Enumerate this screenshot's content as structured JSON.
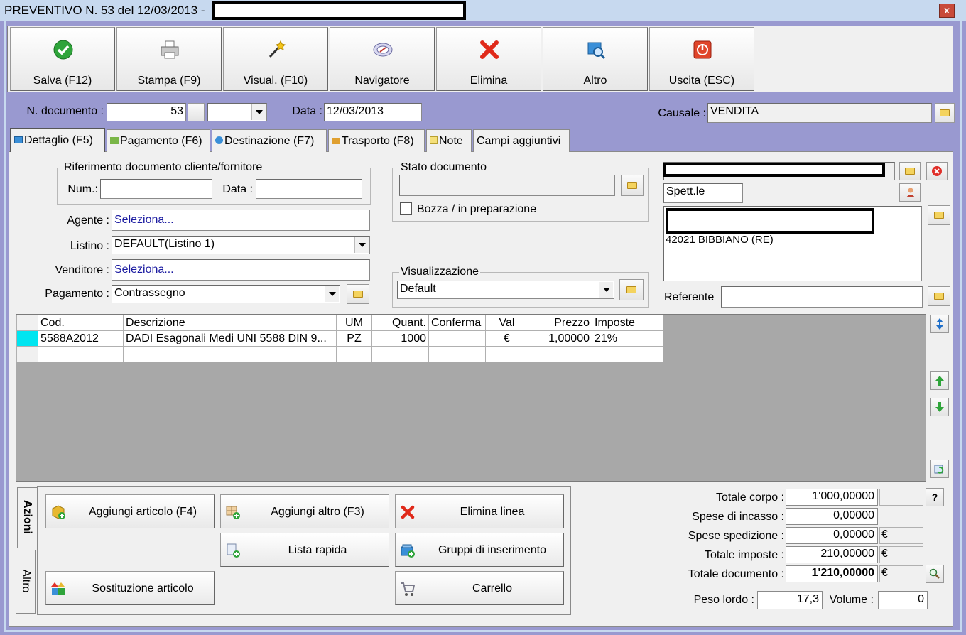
{
  "window": {
    "title": "PREVENTIVO N. 53 del 12/03/2013 -",
    "close": "x"
  },
  "toolbar": [
    {
      "label": "Salva (F12)",
      "icon": "check-icon"
    },
    {
      "label": "Stampa (F9)",
      "icon": "printer-icon"
    },
    {
      "label": "Visual. (F10)",
      "icon": "magic-wand-icon"
    },
    {
      "label": "Navigatore",
      "icon": "compass-icon"
    },
    {
      "label": "Elimina",
      "icon": "delete-x-icon"
    },
    {
      "label": "Altro",
      "icon": "more-icon"
    },
    {
      "label": "Uscita (ESC)",
      "icon": "power-icon"
    }
  ],
  "header": {
    "doc_number_label": "N. documento :",
    "doc_number": "53",
    "date_label": "Data :",
    "date": "12/03/2013",
    "causale_label": "Causale :",
    "causale": "VENDITA"
  },
  "tabs": [
    "Dettaglio (F5)",
    "Pagamento (F6)",
    "Destinazione (F7)",
    "Trasporto (F8)",
    "Note",
    "Campi aggiuntivi"
  ],
  "riferimento": {
    "title": "Riferimento documento cliente/fornitore",
    "num_label": "Num.:",
    "num": "",
    "data_label": "Data :",
    "data": ""
  },
  "fields": {
    "agente_label": "Agente :",
    "agente": "Seleziona...",
    "listino_label": "Listino :",
    "listino": "DEFAULT(Listino 1)",
    "venditore_label": "Venditore :",
    "venditore": "Seleziona...",
    "pagamento_label": "Pagamento :",
    "pagamento": "Contrassegno"
  },
  "stato": {
    "title": "Stato documento",
    "value": "",
    "bozza_label": "Bozza / in preparazione",
    "bozza_checked": false
  },
  "visualizzazione": {
    "title": "Visualizzazione",
    "value": "Default"
  },
  "cliente": {
    "spett": "Spett.le",
    "address": "42021 BIBBIANO (RE)",
    "referente_label": "Referente",
    "referente": ""
  },
  "grid": {
    "columns": [
      "Cod.",
      "Descrizione",
      "UM",
      "Quant.",
      "Conferma",
      "Val",
      "Prezzo",
      "Imposte"
    ],
    "rows": [
      [
        "5588A2012",
        "DADI Esagonali Medi UNI 5588 DIN 9...",
        "PZ",
        "1000",
        "",
        "€",
        "1,00000",
        "21%"
      ]
    ]
  },
  "side_tabs": [
    "Azioni",
    "Altro"
  ],
  "actions": [
    {
      "label": "Aggiungi articolo (F4)",
      "icon": "add-article-icon"
    },
    {
      "label": "Aggiungi altro (F3)",
      "icon": "add-other-icon"
    },
    {
      "label": "Elimina linea",
      "icon": "delete-line-icon"
    },
    {
      "label": "Lista rapida",
      "icon": "quick-list-icon"
    },
    {
      "label": "Gruppi di inserimento",
      "icon": "insert-groups-icon"
    },
    {
      "label": "Sostituzione articolo",
      "icon": "replace-article-icon"
    },
    {
      "label": "Carrello",
      "icon": "cart-icon"
    }
  ],
  "totals": {
    "totale_corpo_label": "Totale corpo :",
    "totale_corpo": "1'000,00000",
    "help": "?",
    "spese_incasso_label": "Spese di incasso :",
    "spese_incasso": "0,00000",
    "spese_spedizione_label": "Spese spedizione :",
    "spese_spedizione": "0,00000",
    "cur1": "€",
    "totale_imposte_label": "Totale imposte :",
    "totale_imposte": "210,00000",
    "cur2": "€",
    "totale_documento_label": "Totale documento :",
    "totale_documento": "1'210,00000",
    "cur3": "€",
    "peso_label": "Peso lordo :",
    "peso": "17,3",
    "volume_label": "Volume :",
    "volume": "0"
  }
}
